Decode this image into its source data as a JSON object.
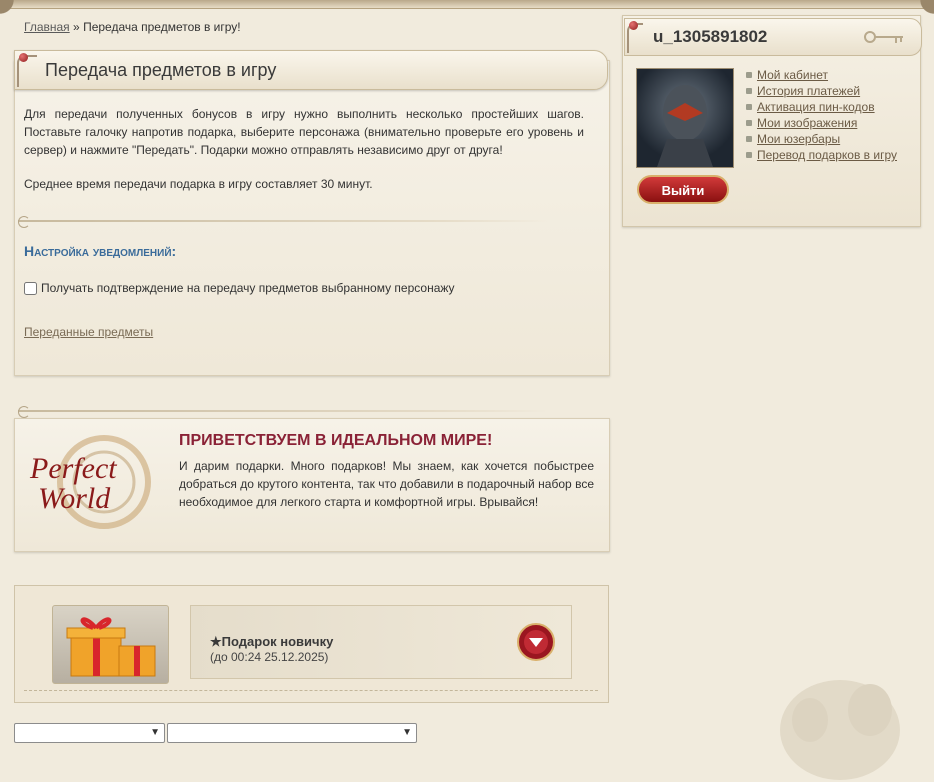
{
  "breadcrumb": {
    "home": "Главная",
    "separator": "»",
    "current": "Передача предметов в игру!"
  },
  "page_title": "Передача предметов в игру",
  "intro": {
    "paragraph": "Для передачи полученных бонусов в игру нужно выполнить несколько простейших шагов. Поставьте галочку напротив подарка, выберите персонажа (внимательно проверьте его уровень и сервер) и нажмите \"Передать\". Подарки можно отправлять независимо друг от друга!",
    "avg_time": "Среднее время передачи подарка в игру составляет 30 минут."
  },
  "notifications": {
    "heading": "Настройка уведомлений:",
    "checkbox_label": "Получать подтверждение на передачу предметов выбранному персонажу",
    "checked": false,
    "transferred_link": "Переданные предметы"
  },
  "welcome": {
    "title": "ПРИВЕТСТВУЕМ В ИДЕАЛЬНОМ МИРЕ!",
    "text": "И дарим подарки. Много подарков! Мы знаем, как хочется побыстрее добраться до крутого контента, так что добавили в подарочный набор все необходимое для легкого старта и комфортной игры. Врывайся!",
    "logo_line1": "Perfect",
    "logo_line2": "World"
  },
  "gift": {
    "name": "★Подарок новичку",
    "until": "(до 00:24 25.12.2025)",
    "icon": "gift-box-icon"
  },
  "selects": {
    "character": "",
    "server": ""
  },
  "sidebar": {
    "username": "u_1305891802",
    "links": [
      "Мой кабинет",
      "История платежей",
      "Активация пин-кодов",
      "Мои изображения",
      "Мои юзербары",
      "Перевод подарков в игру"
    ],
    "logout": "Выйти"
  },
  "colors": {
    "accent_red": "#8a2236",
    "link_blue": "#3a6b9a",
    "bg": "#f1ebdd"
  }
}
